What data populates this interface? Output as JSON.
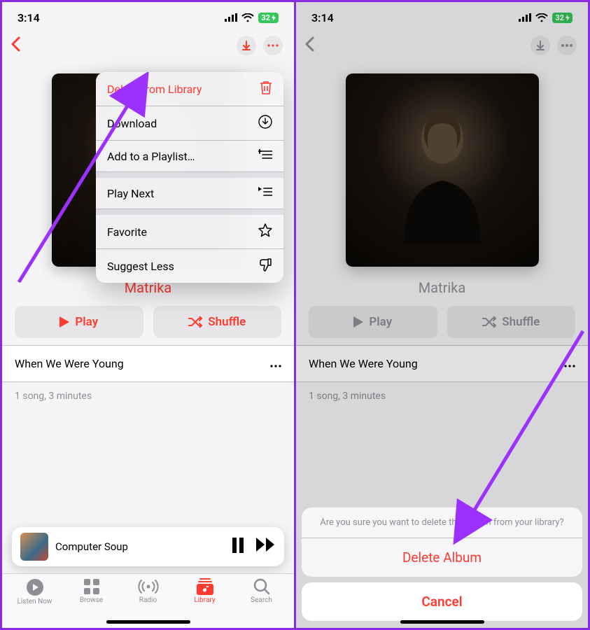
{
  "status": {
    "time": "3:14",
    "battery": "32"
  },
  "album": {
    "title": "Matrika",
    "play": "Play",
    "shuffle": "Shuffle",
    "track": "When We Were Young",
    "meta": "1 song, 3 minutes"
  },
  "now_playing": {
    "title": "Computer Soup"
  },
  "tabs": {
    "listen": "Listen Now",
    "browse": "Browse",
    "radio": "Radio",
    "library": "Library",
    "search": "Search"
  },
  "menu": {
    "delete": "Delete from Library",
    "download": "Download",
    "playlist": "Add to a Playlist…",
    "playnext": "Play Next",
    "favorite": "Favorite",
    "suggestless": "Suggest Less"
  },
  "sheet": {
    "msg": "Are you sure you want to delete this album from your library?",
    "delete": "Delete Album",
    "cancel": "Cancel"
  }
}
